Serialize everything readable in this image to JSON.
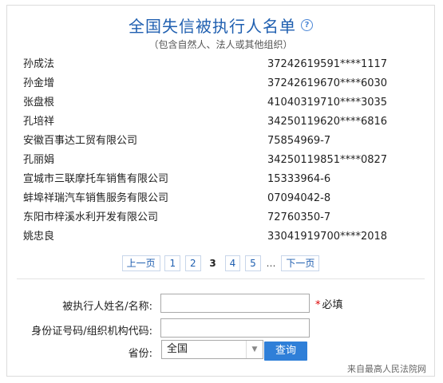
{
  "header": {
    "title": "全国失信被执行人名单",
    "help_icon": "?",
    "subtitle": "（包含自然人、法人或其他组织）"
  },
  "records": [
    {
      "name": "孙成法",
      "code": "37242619591****1117"
    },
    {
      "name": "孙金增",
      "code": "37242619670****6030"
    },
    {
      "name": "张盘根",
      "code": "41040319710****3035"
    },
    {
      "name": "孔培祥",
      "code": "34250119620****6816"
    },
    {
      "name": "安徽百事达工贸有限公司",
      "code": "75854969-7"
    },
    {
      "name": "孔丽娟",
      "code": "34250119851****0827"
    },
    {
      "name": "宣城市三联摩托车销售有限公司",
      "code": "15333964-6"
    },
    {
      "name": "蚌埠祥瑞汽车销售服务有限公司",
      "code": "07094042-8"
    },
    {
      "name": "东阳市梓溪水利开发有限公司",
      "code": "72760350-7"
    },
    {
      "name": "姚忠良",
      "code": "33041919700****2018"
    }
  ],
  "pagination": {
    "prev": "上一页",
    "pages": [
      "1",
      "2",
      "3",
      "4",
      "5"
    ],
    "current": "3",
    "ellipsis": "…",
    "next": "下一页"
  },
  "form": {
    "name_label": "被执行人姓名/名称:",
    "name_value": "",
    "required_star": "*",
    "required_text": "必填",
    "id_label": "身份证号码/组织机构代码:",
    "id_value": "",
    "province_label": "省份:",
    "province_value": "全国",
    "submit_label": "查询"
  },
  "footer": {
    "source": "来自最高人民法院网"
  },
  "colors": {
    "title": "#1f5fb0",
    "link": "#1f5fb0",
    "button": "#2f7fd8",
    "required": "#dd0000"
  },
  "icons": {
    "help": "help-icon",
    "dropdown": "chevron-down-icon"
  }
}
